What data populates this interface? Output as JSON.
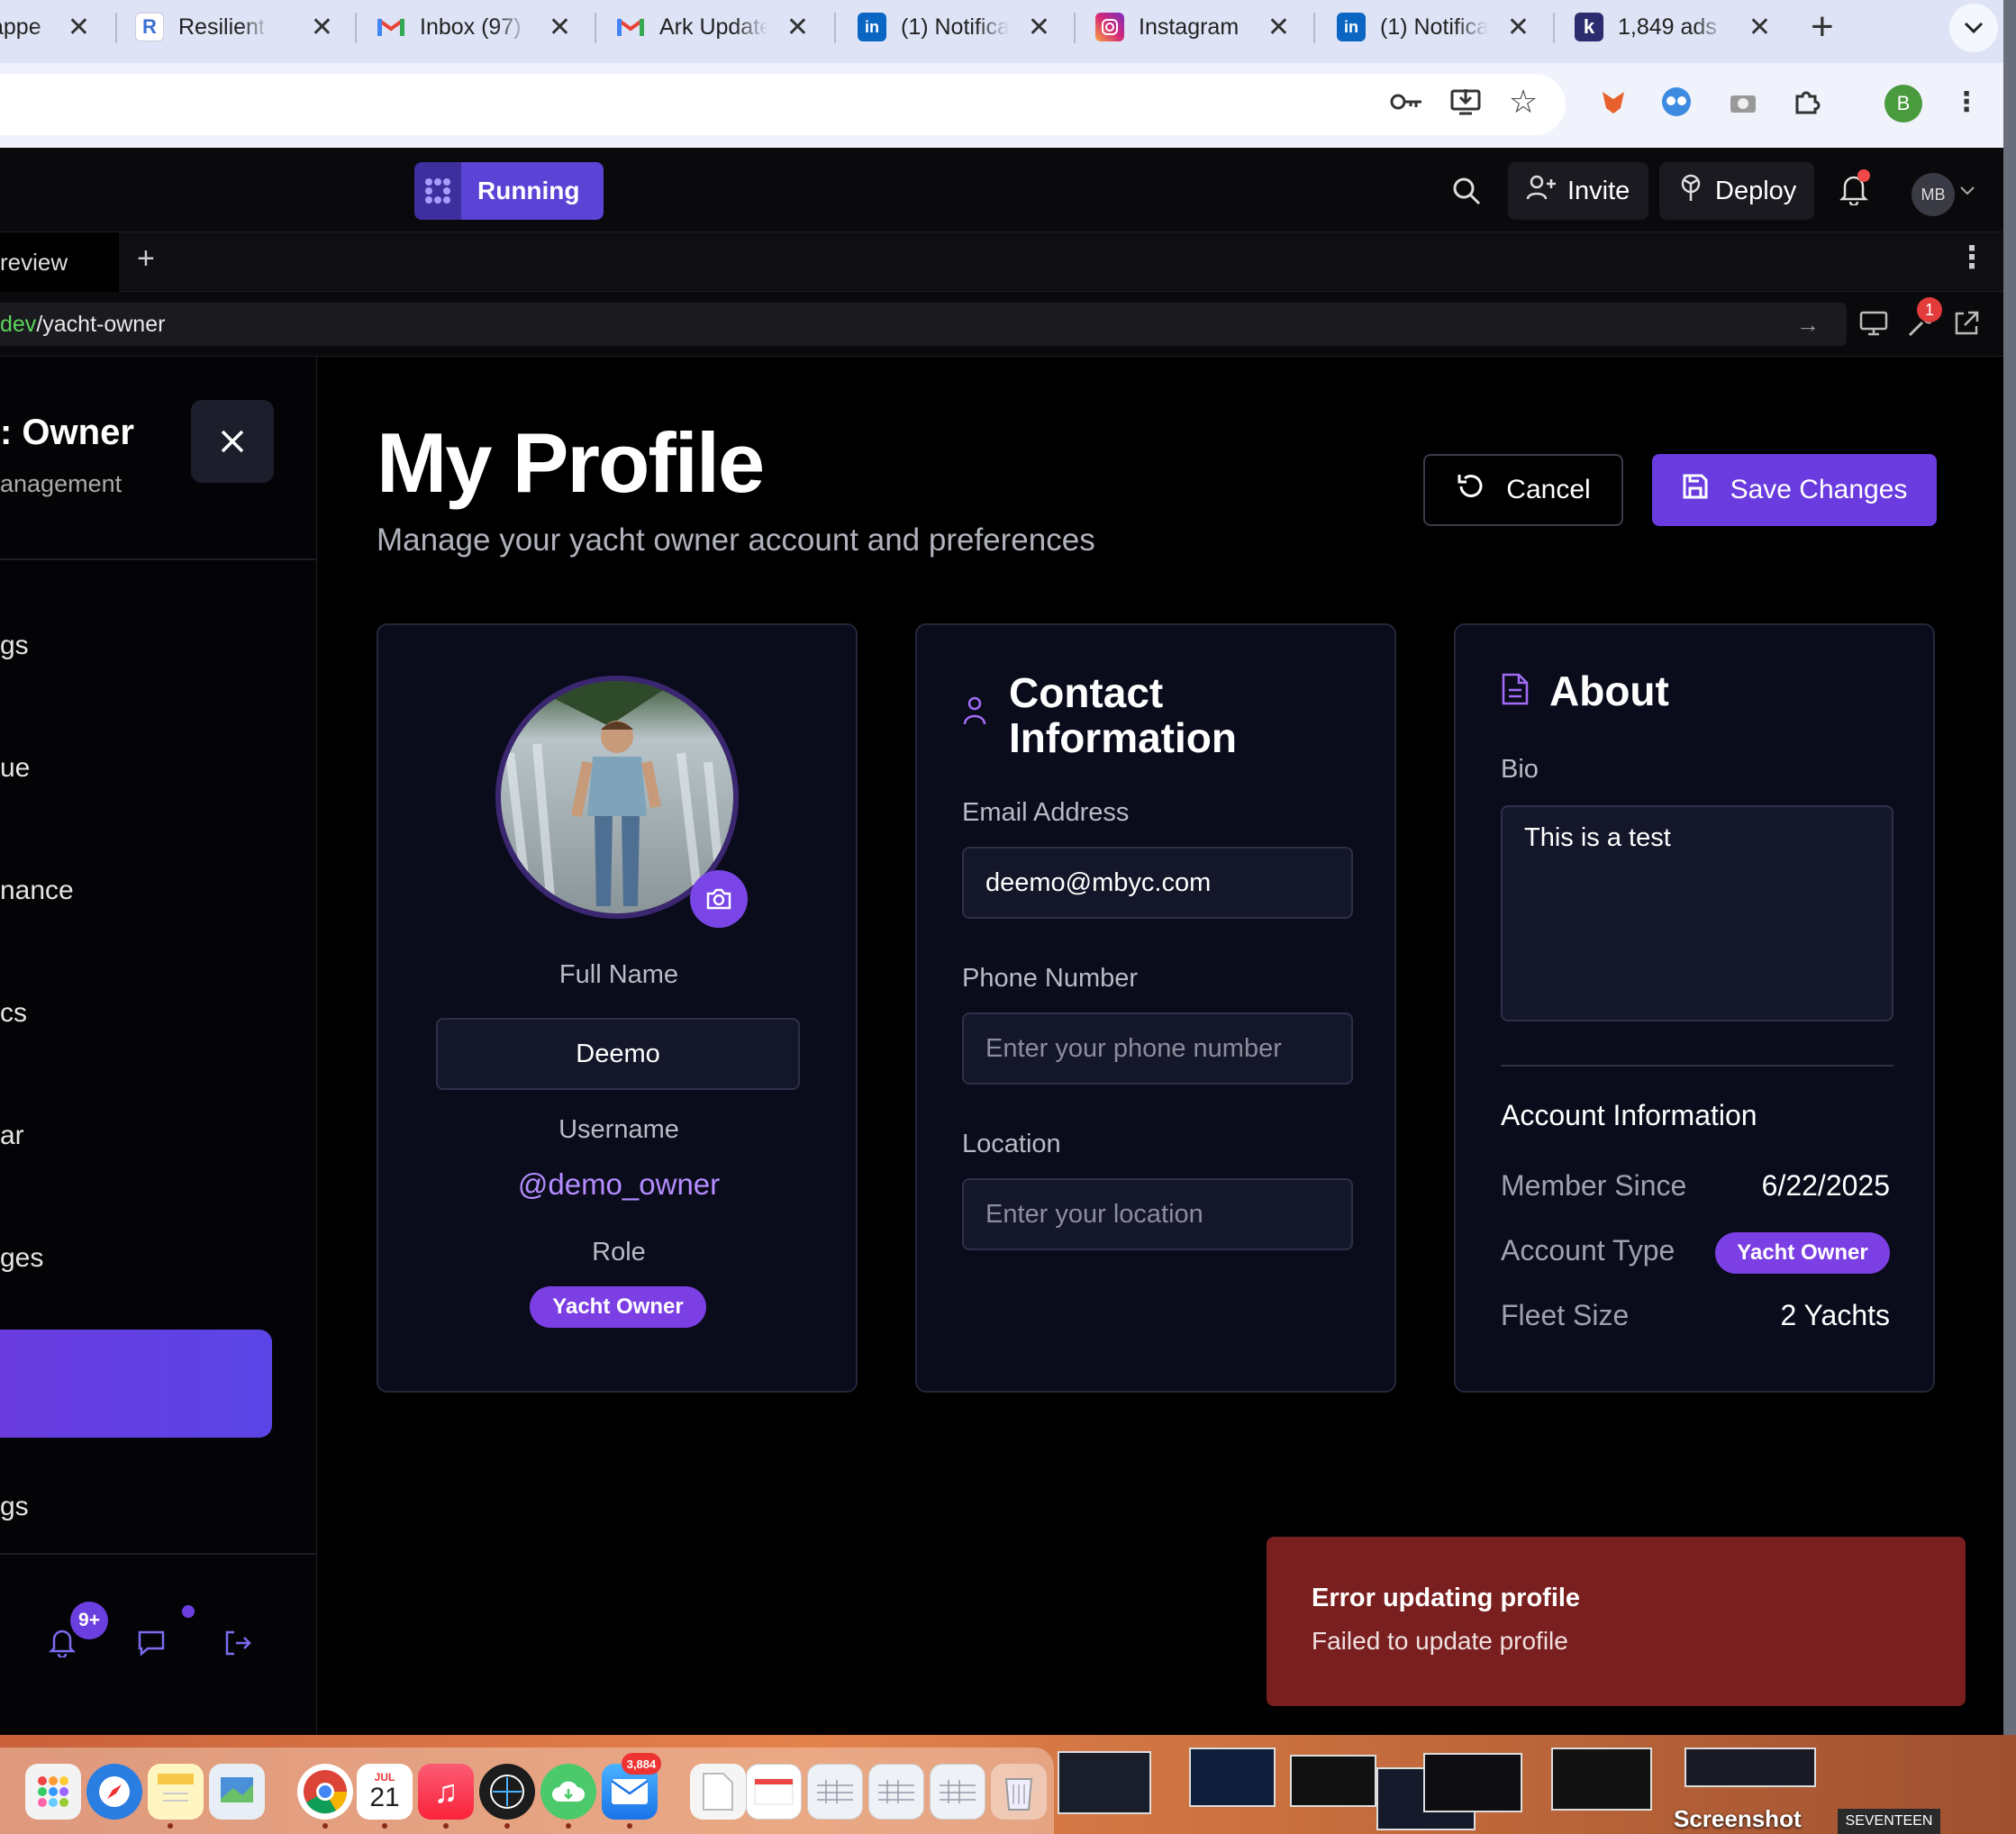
{
  "browser": {
    "tabs": [
      {
        "title": "appe",
        "icon": "generic-icon",
        "color": "#888888"
      },
      {
        "title": "Resilient H",
        "icon": "resilient-icon",
        "color": "#3b6fd4"
      },
      {
        "title": "Inbox (97)",
        "icon": "gmail-icon",
        "color": "#ea4335"
      },
      {
        "title": "Ark Update",
        "icon": "gmail-icon",
        "color": "#ea4335"
      },
      {
        "title": "(1) Notifica",
        "icon": "linkedin-icon",
        "color": "#0a66c2"
      },
      {
        "title": "Instagram",
        "icon": "instagram-icon",
        "color": "#d62976"
      },
      {
        "title": "(1) Notifica",
        "icon": "linkedin-icon",
        "color": "#0a66c2"
      },
      {
        "title": "1,849 ads",
        "icon": "k-icon",
        "color": "#2b2d6e"
      }
    ],
    "profile_initial": "B"
  },
  "app": {
    "status": "Running",
    "invite": "Invite",
    "deploy": "Deploy",
    "avatar": "MB",
    "preview_tab": "review",
    "url_prefix": "dev",
    "url_path": "/yacht-owner",
    "tools_badge": "1"
  },
  "sidebar": {
    "title": ": Owner",
    "subtitle": "anagement",
    "items": [
      "gs",
      "ue",
      "nance",
      "cs",
      "ar",
      "ges",
      "",
      "gs"
    ],
    "notif_badge": "9+"
  },
  "page": {
    "title": "My Profile",
    "subtitle": "Manage your yacht owner account and preferences",
    "cancel": "Cancel",
    "save": "Save Changes"
  },
  "profile_card": {
    "full_name_label": "Full Name",
    "full_name": "Deemo",
    "username_label": "Username",
    "username": "@demo_owner",
    "role_label": "Role",
    "role": "Yacht Owner"
  },
  "contact_card": {
    "heading": "Contact Information",
    "email_label": "Email Address",
    "email": "deemo@mbyc.com",
    "phone_label": "Phone Number",
    "phone_placeholder": "Enter your phone number",
    "location_label": "Location",
    "location_placeholder": "Enter your location"
  },
  "about_card": {
    "heading": "About",
    "bio_label": "Bio",
    "bio": "This is a test",
    "account_heading": "Account Information",
    "member_since_label": "Member Since",
    "member_since": "6/22/2025",
    "account_type_label": "Account Type",
    "account_type": "Yacht Owner",
    "fleet_size_label": "Fleet Size",
    "fleet_size": "2 Yachts"
  },
  "toast": {
    "title": "Error updating profile",
    "message": "Failed to update profile"
  },
  "dock": {
    "calendar_month": "JUL",
    "calendar_day": "21",
    "mail_badge": "3,884",
    "screenshot_label": "Screenshot",
    "seventeen_label": "SEVENTEEN"
  },
  "colors": {
    "accent": "#6a3ce0",
    "error": "#7a1f1f",
    "card_bg": "#0a0c1c"
  }
}
